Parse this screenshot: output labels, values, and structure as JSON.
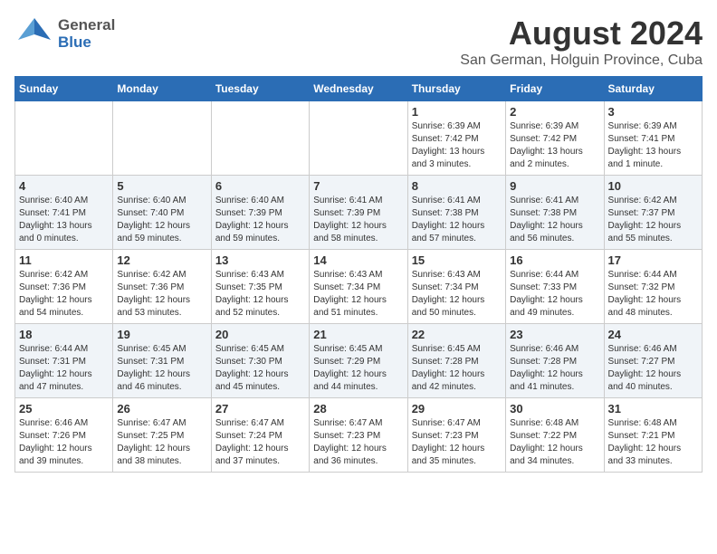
{
  "header": {
    "logo_general": "General",
    "logo_blue": "Blue",
    "title": "August 2024",
    "subtitle": "San German, Holguin Province, Cuba"
  },
  "days_of_week": [
    "Sunday",
    "Monday",
    "Tuesday",
    "Wednesday",
    "Thursday",
    "Friday",
    "Saturday"
  ],
  "weeks": [
    {
      "days": [
        {
          "number": "",
          "info": ""
        },
        {
          "number": "",
          "info": ""
        },
        {
          "number": "",
          "info": ""
        },
        {
          "number": "",
          "info": ""
        },
        {
          "number": "1",
          "info": "Sunrise: 6:39 AM\nSunset: 7:42 PM\nDaylight: 13 hours\nand 3 minutes."
        },
        {
          "number": "2",
          "info": "Sunrise: 6:39 AM\nSunset: 7:42 PM\nDaylight: 13 hours\nand 2 minutes."
        },
        {
          "number": "3",
          "info": "Sunrise: 6:39 AM\nSunset: 7:41 PM\nDaylight: 13 hours\nand 1 minute."
        }
      ]
    },
    {
      "days": [
        {
          "number": "4",
          "info": "Sunrise: 6:40 AM\nSunset: 7:41 PM\nDaylight: 13 hours\nand 0 minutes."
        },
        {
          "number": "5",
          "info": "Sunrise: 6:40 AM\nSunset: 7:40 PM\nDaylight: 12 hours\nand 59 minutes."
        },
        {
          "number": "6",
          "info": "Sunrise: 6:40 AM\nSunset: 7:39 PM\nDaylight: 12 hours\nand 59 minutes."
        },
        {
          "number": "7",
          "info": "Sunrise: 6:41 AM\nSunset: 7:39 PM\nDaylight: 12 hours\nand 58 minutes."
        },
        {
          "number": "8",
          "info": "Sunrise: 6:41 AM\nSunset: 7:38 PM\nDaylight: 12 hours\nand 57 minutes."
        },
        {
          "number": "9",
          "info": "Sunrise: 6:41 AM\nSunset: 7:38 PM\nDaylight: 12 hours\nand 56 minutes."
        },
        {
          "number": "10",
          "info": "Sunrise: 6:42 AM\nSunset: 7:37 PM\nDaylight: 12 hours\nand 55 minutes."
        }
      ]
    },
    {
      "days": [
        {
          "number": "11",
          "info": "Sunrise: 6:42 AM\nSunset: 7:36 PM\nDaylight: 12 hours\nand 54 minutes."
        },
        {
          "number": "12",
          "info": "Sunrise: 6:42 AM\nSunset: 7:36 PM\nDaylight: 12 hours\nand 53 minutes."
        },
        {
          "number": "13",
          "info": "Sunrise: 6:43 AM\nSunset: 7:35 PM\nDaylight: 12 hours\nand 52 minutes."
        },
        {
          "number": "14",
          "info": "Sunrise: 6:43 AM\nSunset: 7:34 PM\nDaylight: 12 hours\nand 51 minutes."
        },
        {
          "number": "15",
          "info": "Sunrise: 6:43 AM\nSunset: 7:34 PM\nDaylight: 12 hours\nand 50 minutes."
        },
        {
          "number": "16",
          "info": "Sunrise: 6:44 AM\nSunset: 7:33 PM\nDaylight: 12 hours\nand 49 minutes."
        },
        {
          "number": "17",
          "info": "Sunrise: 6:44 AM\nSunset: 7:32 PM\nDaylight: 12 hours\nand 48 minutes."
        }
      ]
    },
    {
      "days": [
        {
          "number": "18",
          "info": "Sunrise: 6:44 AM\nSunset: 7:31 PM\nDaylight: 12 hours\nand 47 minutes."
        },
        {
          "number": "19",
          "info": "Sunrise: 6:45 AM\nSunset: 7:31 PM\nDaylight: 12 hours\nand 46 minutes."
        },
        {
          "number": "20",
          "info": "Sunrise: 6:45 AM\nSunset: 7:30 PM\nDaylight: 12 hours\nand 45 minutes."
        },
        {
          "number": "21",
          "info": "Sunrise: 6:45 AM\nSunset: 7:29 PM\nDaylight: 12 hours\nand 44 minutes."
        },
        {
          "number": "22",
          "info": "Sunrise: 6:45 AM\nSunset: 7:28 PM\nDaylight: 12 hours\nand 42 minutes."
        },
        {
          "number": "23",
          "info": "Sunrise: 6:46 AM\nSunset: 7:28 PM\nDaylight: 12 hours\nand 41 minutes."
        },
        {
          "number": "24",
          "info": "Sunrise: 6:46 AM\nSunset: 7:27 PM\nDaylight: 12 hours\nand 40 minutes."
        }
      ]
    },
    {
      "days": [
        {
          "number": "25",
          "info": "Sunrise: 6:46 AM\nSunset: 7:26 PM\nDaylight: 12 hours\nand 39 minutes."
        },
        {
          "number": "26",
          "info": "Sunrise: 6:47 AM\nSunset: 7:25 PM\nDaylight: 12 hours\nand 38 minutes."
        },
        {
          "number": "27",
          "info": "Sunrise: 6:47 AM\nSunset: 7:24 PM\nDaylight: 12 hours\nand 37 minutes."
        },
        {
          "number": "28",
          "info": "Sunrise: 6:47 AM\nSunset: 7:23 PM\nDaylight: 12 hours\nand 36 minutes."
        },
        {
          "number": "29",
          "info": "Sunrise: 6:47 AM\nSunset: 7:23 PM\nDaylight: 12 hours\nand 35 minutes."
        },
        {
          "number": "30",
          "info": "Sunrise: 6:48 AM\nSunset: 7:22 PM\nDaylight: 12 hours\nand 34 minutes."
        },
        {
          "number": "31",
          "info": "Sunrise: 6:48 AM\nSunset: 7:21 PM\nDaylight: 12 hours\nand 33 minutes."
        }
      ]
    }
  ]
}
